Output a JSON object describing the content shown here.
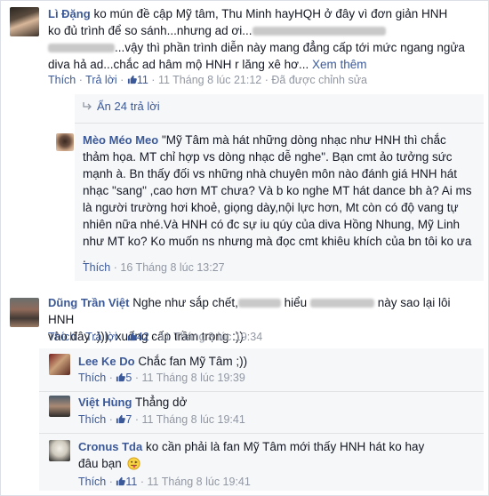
{
  "actions": {
    "like": "Thích",
    "reply": "Trả lời",
    "see_more": "Xem thêm",
    "edited": "Đã được chỉnh sửa",
    "dot": "·"
  },
  "comment1": {
    "author": "Lì Đặng",
    "line1": "ko mún đề cập Mỹ tâm, Thu Minh hayHQH ở đây vì đơn giản HNH",
    "line2a": "ko đủ trình để so sánh...nhưng ad ơi...",
    "line3a": "...vậy thì phần trình diễn này mang đẳng cấp tới mức ngang ngửa",
    "line4": "diva hả ad...chắc ad hâm mộ HNH r lăng xê hơ...",
    "likes": "11",
    "time": "11 Tháng 8 lúc 21:12"
  },
  "hidden_replies": "Ẩn 24 trả lời",
  "reply1": {
    "author": "Mèo Méo Meo",
    "text": "\"Mỹ Tâm mà hát những dòng nhạc như HNH thì chắc thảm họa. MT chỉ hợp vs dòng nhạc dễ nghe\". Bạn cmt ảo tưởng sức mạnh à. Bn thấy đối vs những nhà chuyên môn nào đánh giá HNH hát nhạc \"sang\" ,cao hơn MT chưa? Và b ko nghe MT hát dance bh à? Ai ms là người trường hơi khoẻ, giọng dày,nội lực hơn, Mt còn có độ vang tự nhiên nữa nhé.Và HNH có đc sự iu qúy của diva Hồng Nhung, Mỹ Linh như MT ko? Ko muốn ns nhưng mà đọc cmt khiêu khích của bn tôi ko ưa .",
    "time": "16 Tháng 8 lúc 13:27"
  },
  "comment2": {
    "author": "Dũng Trần Việt",
    "line1a": "Nghe như sắp chết,",
    "line1b": "hiểu",
    "line1c": "này sao lại lôi HNH",
    "line2": "vào đây :))), xuống cấp trầm trọng :))",
    "likes": "42",
    "time": "11 Tháng 8 lúc 19:34"
  },
  "reply2": {
    "author": "Lee Ke Do",
    "text": "Chắc fan Mỹ Tâm ;))",
    "likes": "5",
    "time": "11 Tháng 8 lúc 19:39"
  },
  "reply3": {
    "author": "Việt Hùng",
    "text": "Thẳng dở",
    "likes": "7",
    "time": "11 Tháng 8 lúc 19:41"
  },
  "reply4": {
    "author": "Cronus Tda",
    "line1": "ko cần phải là fan Mỹ Tâm mới thấy HNH hát ko hay",
    "line2": "đâu bạn",
    "likes": "11",
    "time": "11 Tháng 8 lúc 19:41"
  },
  "colors": {
    "link": "#3b5998",
    "meta": "#9197a3",
    "text": "#141823",
    "indent_bg": "#f6f7f9"
  }
}
